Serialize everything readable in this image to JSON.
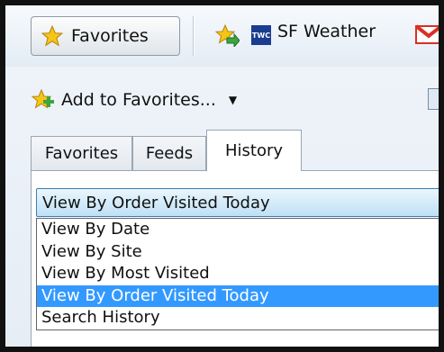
{
  "toolbar": {
    "favorites_label": "Favorites",
    "quick_link": "SF Weather",
    "twc_badge": "TWC"
  },
  "panel": {
    "add_label": "Add to Favorites...",
    "tabs": [
      {
        "label": "Favorites"
      },
      {
        "label": "Feeds"
      },
      {
        "label": "History"
      }
    ],
    "active_tab": "History"
  },
  "history_view": {
    "selected": "View By Order Visited Today",
    "options": [
      {
        "label": "View By Date"
      },
      {
        "label": "View By Site"
      },
      {
        "label": "View By Most Visited"
      },
      {
        "label": "View By Order Visited Today"
      },
      {
        "label": "Search History"
      }
    ]
  },
  "colors": {
    "selection": "#3399ff",
    "star": "#f5c518",
    "gmail": "#d93025"
  }
}
